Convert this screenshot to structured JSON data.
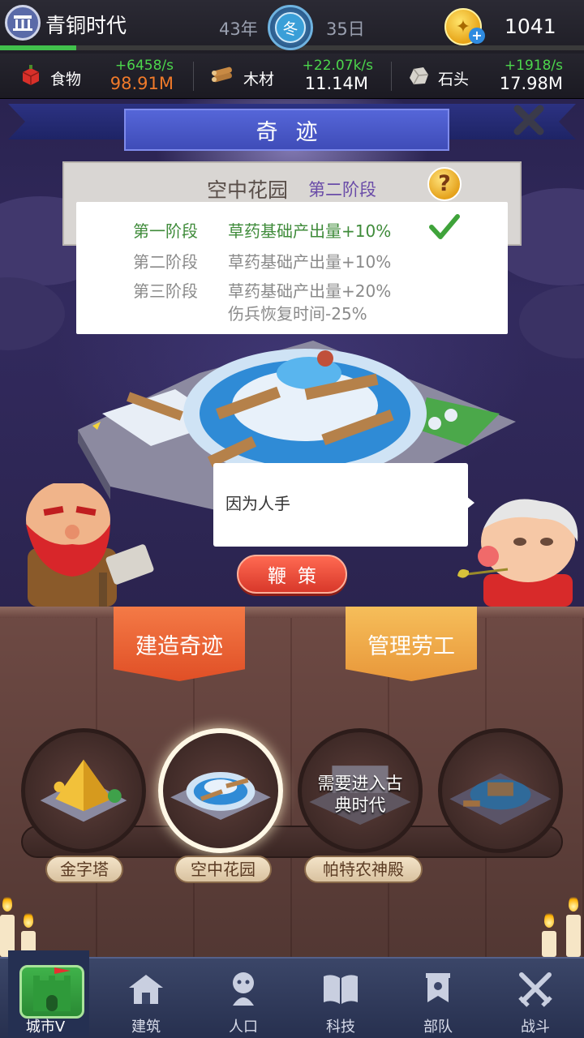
{
  "header": {
    "era_name": "青铜时代",
    "year": "43年",
    "season": "冬",
    "day": "35日",
    "gold": "1041",
    "era_progress": 0.13
  },
  "resources": [
    {
      "label": "食物",
      "rate": "+6458/s",
      "amount": "98.91M",
      "amount_color": "#f07a2a",
      "icon": "food-icon"
    },
    {
      "label": "木材",
      "rate": "+22.07k/s",
      "amount": "11.14M",
      "amount_color": "#ffffff",
      "icon": "wood-icon"
    },
    {
      "label": "石头",
      "rate": "+1918/s",
      "amount": "17.98M",
      "amount_color": "#ffffff",
      "icon": "stone-icon"
    }
  ],
  "panel": {
    "title": "奇迹",
    "wonder_name": "空中花园",
    "wonder_stage": "第二阶段"
  },
  "stages": [
    {
      "stage": "第一阶段",
      "effect": "草药基础产出量+10%",
      "effect2": "",
      "completed": true
    },
    {
      "stage": "第二阶段",
      "effect": "草药基础产出量+10%",
      "effect2": "",
      "completed": false
    },
    {
      "stage": "第三阶段",
      "effect": "草药基础产出量+20%",
      "effect2": "伤兵恢复时间-25%",
      "completed": false
    }
  ],
  "speech": "因为人手",
  "whip_label": "鞭策",
  "tabs": {
    "build": "建造奇迹",
    "manage": "管理劳工"
  },
  "wonders": [
    {
      "name": "金字塔",
      "locked_text": ""
    },
    {
      "name": "空中花园",
      "locked_text": ""
    },
    {
      "name": "帕特农神殿",
      "locked_text_1": "需要进入古",
      "locked_text_2": "典时代"
    },
    {
      "name": "",
      "locked_text": ""
    }
  ],
  "nav": [
    {
      "label": "城市V"
    },
    {
      "label": "建筑"
    },
    {
      "label": "人口"
    },
    {
      "label": "科技"
    },
    {
      "label": "部队"
    },
    {
      "label": "战斗"
    }
  ],
  "colors": {
    "positive_rate": "#4cd74c",
    "completed_stage": "#3f8b3a",
    "pending_stage": "#8a8a8a",
    "title_plate": "#4b5ad0",
    "whip_button": "#e8493a",
    "build_tab": "#e85a30",
    "manage_tab": "#eea445"
  }
}
